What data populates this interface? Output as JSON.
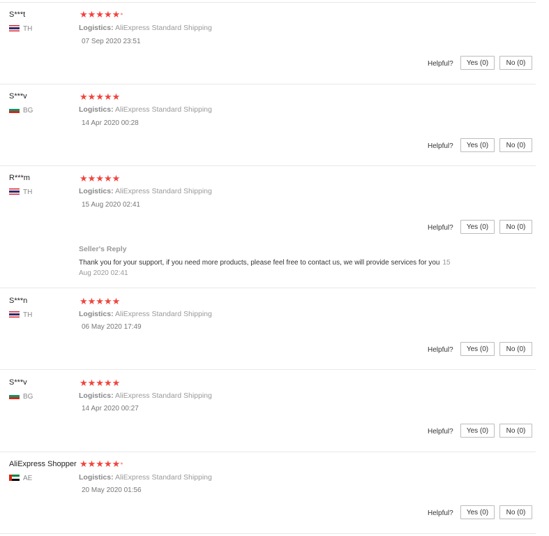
{
  "ui": {
    "logistics_label": "Logistics:",
    "helpful_label": "Helpful?"
  },
  "reviews": [
    {
      "user": "S***t",
      "country": "TH",
      "flag": "thailand-flag-icon",
      "rating": 5,
      "logistics": "AliExpress Standard Shipping",
      "date": "07 Sep 2020 23:51",
      "yes": "Yes (0)",
      "no": "No (0)"
    },
    {
      "user": "S***v",
      "country": "BG",
      "flag": "bulgaria-flag-icon",
      "rating": 5,
      "logistics": "AliExpress Standard Shipping",
      "date": "14 Apr 2020 00:28",
      "yes": "Yes (0)",
      "no": "No (0)"
    },
    {
      "user": "R***m",
      "country": "TH",
      "flag": "thailand-flag-icon",
      "rating": 5,
      "logistics": "AliExpress Standard Shipping",
      "date": "15 Aug 2020 02:41",
      "yes": "Yes (0)",
      "no": "No (0)",
      "seller_reply": {
        "title": "Seller's Reply",
        "text": "Thank you for your support, if you need more products, please feel free to contact us, we will provide services for you",
        "date": "15 Aug 2020 02:41"
      }
    },
    {
      "user": "S***n",
      "country": "TH",
      "flag": "thailand-flag-icon",
      "rating": 5,
      "logistics": "AliExpress Standard Shipping",
      "date": "06 May 2020 17:49",
      "yes": "Yes (0)",
      "no": "No (0)"
    },
    {
      "user": "S***v",
      "country": "BG",
      "flag": "bulgaria-flag-icon",
      "rating": 5,
      "logistics": "AliExpress Standard Shipping",
      "date": "14 Apr 2020 00:27",
      "yes": "Yes (0)",
      "no": "No (0)"
    },
    {
      "user": "AliExpress Shopper",
      "country": "AE",
      "flag": "uae-flag-icon",
      "rating": 5,
      "logistics": "AliExpress Standard Shipping",
      "date": "20 May 2020 01:56",
      "yes": "Yes (0)",
      "no": "No (0)"
    }
  ]
}
